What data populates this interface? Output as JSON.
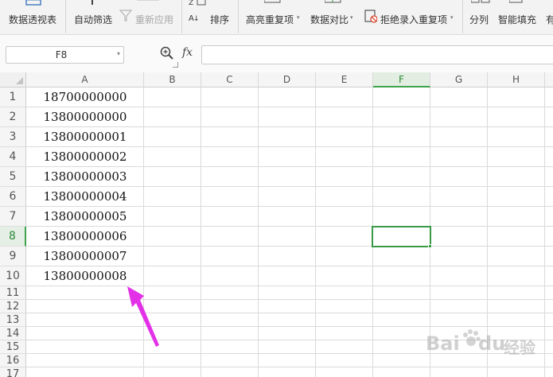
{
  "ribbon": {
    "buttons": [
      {
        "label": "数据透视表",
        "disabled": false
      },
      {
        "label": "自动筛选",
        "disabled": false
      },
      {
        "label": "重新应用",
        "disabled": true
      },
      {
        "label": "排序",
        "disabled": false
      },
      {
        "label": "高亮重复项",
        "disabled": false,
        "dropdown": true
      },
      {
        "label": "数据对比",
        "disabled": false,
        "dropdown": true
      },
      {
        "label": "拒绝录入重复项",
        "disabled": false,
        "dropdown": true
      },
      {
        "label": "分列",
        "disabled": false
      },
      {
        "label": "智能填充",
        "disabled": false
      },
      {
        "label": "有",
        "disabled": false
      }
    ]
  },
  "formula_bar": {
    "name_box": "F8",
    "fx_label": "fx",
    "formula": ""
  },
  "grid": {
    "columns": [
      "A",
      "B",
      "C",
      "D",
      "E",
      "F",
      "G",
      "H"
    ],
    "selected_column": "F",
    "rows": [
      "1",
      "2",
      "3",
      "4",
      "5",
      "6",
      "7",
      "8",
      "9",
      "10",
      "11",
      "12",
      "13",
      "14",
      "15",
      "16",
      "17"
    ],
    "selected_row": "8",
    "column_a_values": [
      "18700000000",
      "13800000000",
      "13800000001",
      "13800000002",
      "13800000003",
      "13800000004",
      "13800000005",
      "13800000006",
      "13800000007",
      "13800000008"
    ]
  },
  "annotation": {
    "arrow_color": "#e331e8"
  },
  "accent": {
    "selection_green": "#3a9a48"
  },
  "watermark": {
    "text": "Bai",
    "text2": "du",
    "text3": "经验"
  }
}
